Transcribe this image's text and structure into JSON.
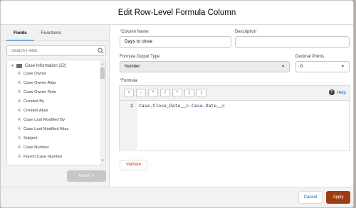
{
  "dialog": {
    "title": "Edit Row-Level Formula Column"
  },
  "left_panel": {
    "tabs": [
      "Fields",
      "Functions"
    ],
    "active_tab": "Fields",
    "search_placeholder": "Search Fields",
    "folder": "Case Information (22)",
    "fields": [
      "Case Owner",
      "Case Owner Alias",
      "Case Owner Role",
      "Created By",
      "Created Alias",
      "Case Last Modified By",
      "Case Last Modified Alias",
      "Subject",
      "Case Number",
      "Parent Case Number"
    ],
    "field_type_glyph": "A",
    "insert_label": "Insert"
  },
  "form": {
    "required_marker": "*",
    "column_name_label": "Column Name",
    "column_name_value": "Days to close",
    "description_label": "Description",
    "description_value": "",
    "output_type_label": "Formula Output Type",
    "output_type_value": "Number",
    "decimal_label": "Decimal Points",
    "decimal_value": "0",
    "formula_label": "Formula"
  },
  "editor": {
    "operators": [
      "+",
      "-",
      "*",
      "/",
      "^",
      "(",
      ")"
    ],
    "help_label": "Help",
    "line_number": "1",
    "code": "Case.Close_Date__c-Case.Date__c"
  },
  "actions": {
    "validate": "Validate",
    "cancel": "Cancel",
    "apply": "Apply"
  },
  "colors": {
    "brand_blue": "#0070d2",
    "apply_bg": "#9e3d12",
    "error_red": "#c23934"
  }
}
